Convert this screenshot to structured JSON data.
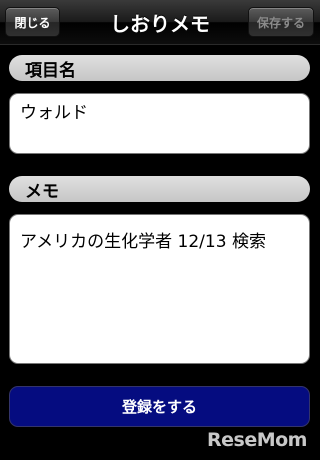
{
  "navbar": {
    "close_label": "閉じる",
    "title": "しおりメモ",
    "save_label": "保存する"
  },
  "form": {
    "item_name_label": "項目名",
    "item_name_value": "ウォルド",
    "memo_label": "メモ",
    "memo_value": "アメリカの生化学者 12/13 検索",
    "submit_label": "登録をする"
  },
  "watermark": {
    "text": "ReseMom"
  },
  "colors": {
    "background": "#000000",
    "label_pill": "#d4d4d4",
    "submit_button": "#050c80",
    "disabled_text": "#8a8a8a"
  }
}
